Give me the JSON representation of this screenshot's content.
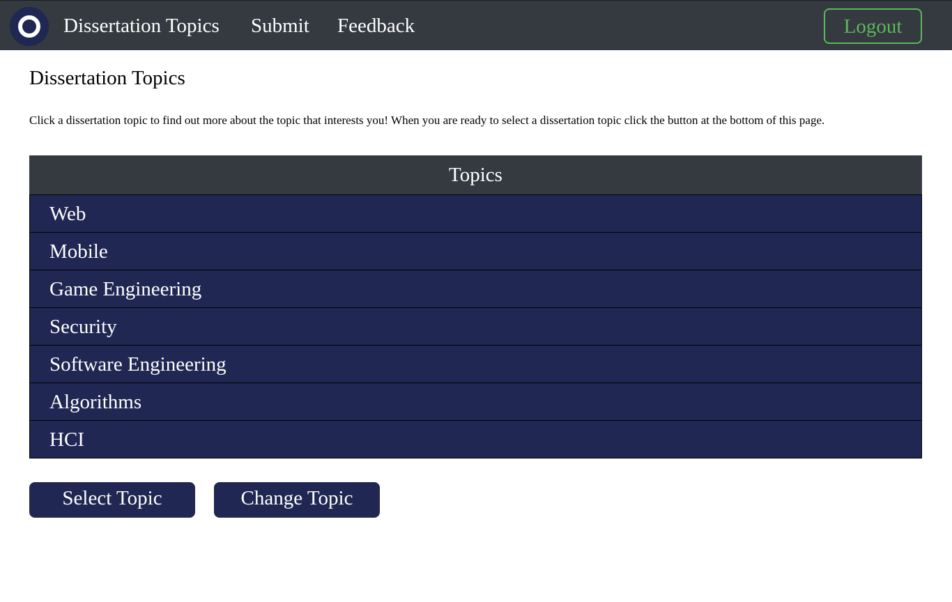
{
  "nav": {
    "logo_icon": "ring-logo-icon",
    "links": [
      "Dissertation Topics",
      "Submit",
      "Feedback"
    ],
    "logout_label": "Logout"
  },
  "main": {
    "title": "Dissertation Topics",
    "intro": "Click a dissertation topic to find out more about the topic that interests you! When you are ready to select a dissertation topic click the button at the bottom of this page."
  },
  "topics": {
    "header": "Topics",
    "items": [
      "Web",
      "Mobile",
      "Game Engineering",
      "Security",
      "Software Engineering",
      "Algorithms",
      "HCI"
    ]
  },
  "actions": {
    "select_label": "Select Topic",
    "change_label": "Change Topic"
  },
  "colors": {
    "navbar_bg": "#343a40",
    "brand_navy": "#1f2752",
    "logout_green": "#5cb85c"
  }
}
